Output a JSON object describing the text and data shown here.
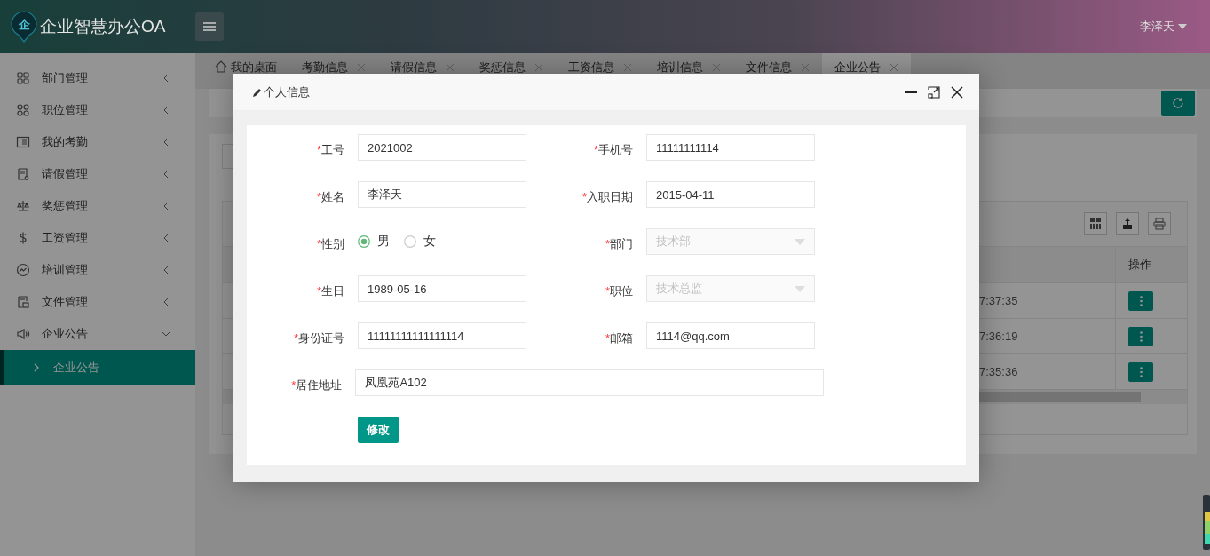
{
  "header": {
    "logo_glyph": "企",
    "title": "企业智慧办公OA",
    "user": "李泽天"
  },
  "sidebar": {
    "items": [
      {
        "label": "部门管理",
        "kind": "grid",
        "expanded": false
      },
      {
        "label": "职位管理",
        "kind": "clover",
        "expanded": false
      },
      {
        "label": "我的考勤",
        "kind": "card",
        "expanded": false
      },
      {
        "label": "请假管理",
        "kind": "form",
        "expanded": false
      },
      {
        "label": "奖惩管理",
        "kind": "scale",
        "expanded": false
      },
      {
        "label": "工资管理",
        "kind": "dollar",
        "expanded": false
      },
      {
        "label": "培训管理",
        "kind": "chart",
        "expanded": false
      },
      {
        "label": "文件管理",
        "kind": "file",
        "expanded": false
      },
      {
        "label": "企业公告",
        "kind": "speaker",
        "expanded": true,
        "children": [
          {
            "label": "企业公告",
            "selected": true
          }
        ]
      }
    ]
  },
  "tabs": [
    {
      "label": "我的桌面",
      "kind": "home",
      "selected": false
    },
    {
      "label": "考勤信息",
      "kind": "closable",
      "selected": false
    },
    {
      "label": "请假信息",
      "kind": "closable",
      "selected": false
    },
    {
      "label": "奖惩信息",
      "kind": "closable",
      "selected": false
    },
    {
      "label": "工资信息",
      "kind": "closable",
      "selected": false
    },
    {
      "label": "培训信息",
      "kind": "closable",
      "selected": false
    },
    {
      "label": "文件信息",
      "kind": "closable",
      "selected": false
    },
    {
      "label": "企业公告",
      "kind": "closable",
      "selected": true
    }
  ],
  "table": {
    "columns": [
      {
        "label": "操作"
      }
    ],
    "rows": [
      {
        "column_1": "7:37:35"
      },
      {
        "column_1": "7:36:19"
      },
      {
        "column_1": "7:35:36"
      }
    ]
  },
  "dialog": {
    "title": "个人信息",
    "fields": [
      {
        "mark": "*",
        "label": "工号",
        "kind": "text",
        "value": "2021002",
        "disabled": false
      },
      {
        "mark": "*",
        "label": "手机号",
        "kind": "text",
        "value": "11111111114",
        "disabled": false
      },
      {
        "mark": "*",
        "label": "姓名",
        "kind": "text",
        "value": "李泽天",
        "disabled": false
      },
      {
        "mark": "*",
        "label": "入职日期",
        "kind": "text",
        "value": "2015-04-11",
        "disabled": false
      },
      {
        "mark": "*",
        "label": "性别",
        "kind": "radio",
        "options": [
          {
            "label": "男",
            "selected": true
          },
          {
            "label": "女",
            "selected": false
          }
        ]
      },
      {
        "mark": "*",
        "label": "部门",
        "kind": "select",
        "value": "技术部",
        "disabled": true
      },
      {
        "mark": "*",
        "label": "生日",
        "kind": "text",
        "value": "1989-05-16",
        "disabled": false
      },
      {
        "mark": "*",
        "label": "职位",
        "kind": "select",
        "value": "技术总监",
        "disabled": true
      },
      {
        "mark": "*",
        "label": "身份证号",
        "kind": "text",
        "value": "11111111111111114",
        "disabled": false
      },
      {
        "mark": "*",
        "label": "邮箱",
        "kind": "text",
        "value": "1114@qq.com",
        "disabled": false
      },
      {
        "mark": "*",
        "label": "居住地址",
        "kind": "wide",
        "value": "凤凰苑A102",
        "disabled": false
      }
    ],
    "submit": "修改"
  }
}
